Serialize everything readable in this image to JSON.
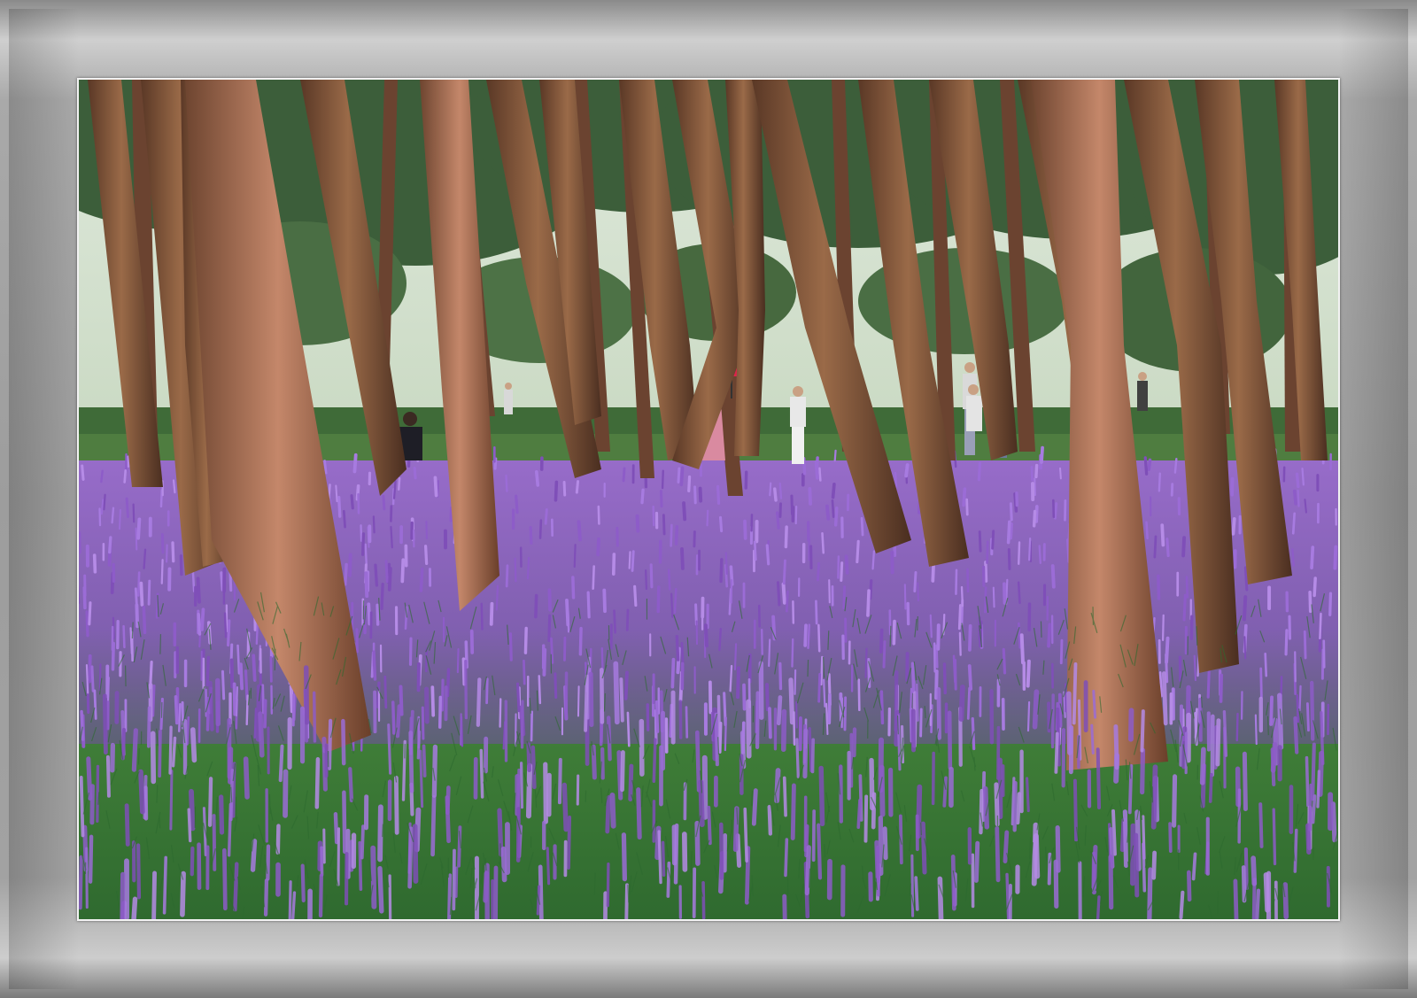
{
  "image": {
    "subject": "pine-forest-with-purple-flowers",
    "colors": {
      "frame": "#9d9d9d",
      "mat": "#f2f2f2",
      "sky": "#e8efe6",
      "canopy": "#3c5e3a",
      "trunk": "#8a5a3c",
      "flowers": "#8f5fc6",
      "grass": "#3f7a3a",
      "umbrella": "#e0224a"
    }
  }
}
